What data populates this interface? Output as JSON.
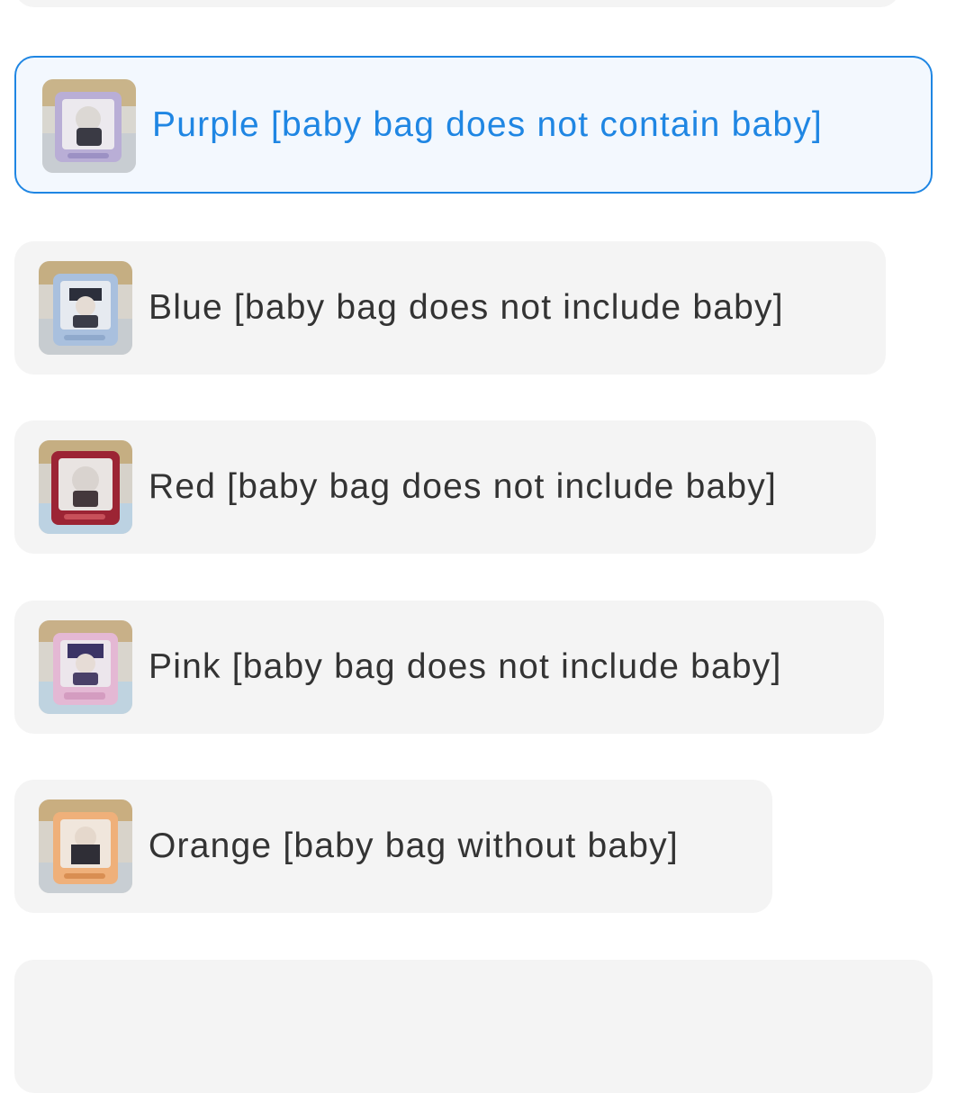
{
  "colors": {
    "accent": "#1f86e3",
    "option_bg": "#f4f4f4",
    "selected_bg": "#f3f8fe",
    "text": "#333333"
  },
  "options": [
    {
      "label": "Purple [baby bag does not contain baby]",
      "selected": true,
      "icon": "purple-bag-thumbnail"
    },
    {
      "label": "Blue [baby bag does not include baby]",
      "selected": false,
      "icon": "blue-bag-thumbnail"
    },
    {
      "label": "Red [baby bag does not include baby]",
      "selected": false,
      "icon": "red-bag-thumbnail"
    },
    {
      "label": "Pink [baby bag does not include baby]",
      "selected": false,
      "icon": "pink-bag-thumbnail"
    },
    {
      "label": "Orange [baby bag without baby]",
      "selected": false,
      "icon": "orange-bag-thumbnail"
    }
  ]
}
